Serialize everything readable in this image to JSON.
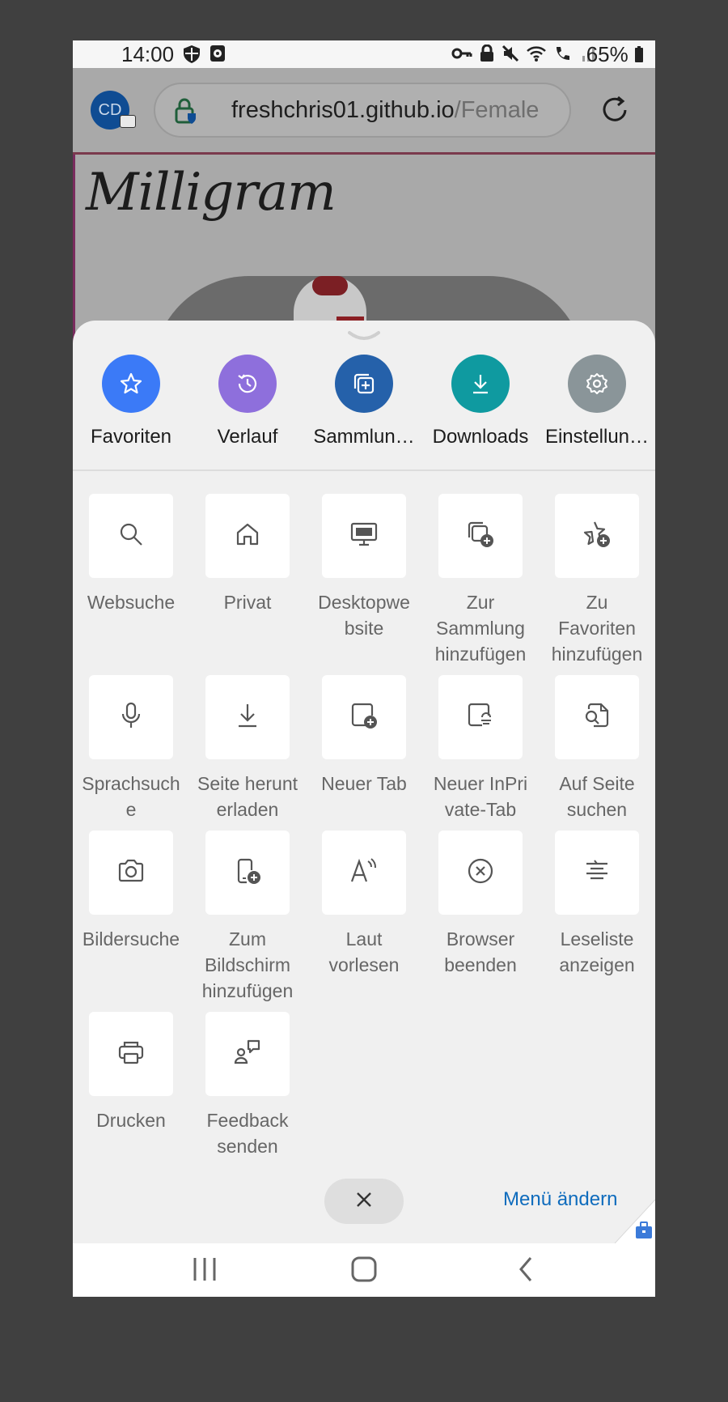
{
  "status": {
    "time": "14:00",
    "battery": "65%",
    "left_icons": [
      "shield-icon",
      "clock-badge-icon"
    ],
    "right_icons": [
      "key-icon",
      "lock-icon",
      "mute-icon",
      "wifi-icon",
      "wifi-call-icon",
      "signal-icon"
    ]
  },
  "browser": {
    "avatar_initials": "CD",
    "url_domain": "freshchris01.github.io",
    "url_path": "/Female",
    "page_logo": "Milligram"
  },
  "quick_actions": [
    {
      "label": "Favoriten",
      "icon": "star-icon",
      "color": "#3b7af7"
    },
    {
      "label": "Verlauf",
      "icon": "history-icon",
      "color": "#8e6fdc"
    },
    {
      "label": "Sammlun…",
      "icon": "collections-icon",
      "color": "#2561aa"
    },
    {
      "label": "Downloads",
      "icon": "download-icon",
      "color": "#0f9aa0"
    },
    {
      "label": "Einstellun…",
      "icon": "settings-icon",
      "color": "#8a9599"
    }
  ],
  "tiles": [
    {
      "label": "Websuche",
      "icon": "search-icon"
    },
    {
      "label": "Privat",
      "icon": "home-icon"
    },
    {
      "label": "Desktopwe\nbsite",
      "icon": "desktop-icon"
    },
    {
      "label": "Zur\nSammlung\nhinzufügen",
      "icon": "add-collection-icon"
    },
    {
      "label": "Zu\nFavoriten\nhinzufügen",
      "icon": "add-favorite-icon"
    },
    {
      "label": "Sprachsuch\ne",
      "icon": "microphone-icon"
    },
    {
      "label": "Seite herunt\nerladen",
      "icon": "download-page-icon"
    },
    {
      "label": "Neuer Tab",
      "icon": "new-tab-icon"
    },
    {
      "label": "Neuer InPri\nvate-Tab",
      "icon": "inprivate-tab-icon"
    },
    {
      "label": "Auf Seite\nsuchen",
      "icon": "find-on-page-icon"
    },
    {
      "label": "Bildersuche",
      "icon": "camera-icon"
    },
    {
      "label": "Zum\nBildschirm\nhinzufügen",
      "icon": "add-to-homescreen-icon"
    },
    {
      "label": "Laut\nvorlesen",
      "icon": "read-aloud-icon"
    },
    {
      "label": "Browser\nbeenden",
      "icon": "exit-browser-icon"
    },
    {
      "label": "Leseliste\nanzeigen",
      "icon": "reading-list-icon"
    },
    {
      "label": "Drucken",
      "icon": "print-icon"
    },
    {
      "label": "Feedback\nsenden",
      "icon": "feedback-icon"
    }
  ],
  "footer": {
    "edit_menu_label": "Menü ändern",
    "accent": "#0f6cbd"
  }
}
